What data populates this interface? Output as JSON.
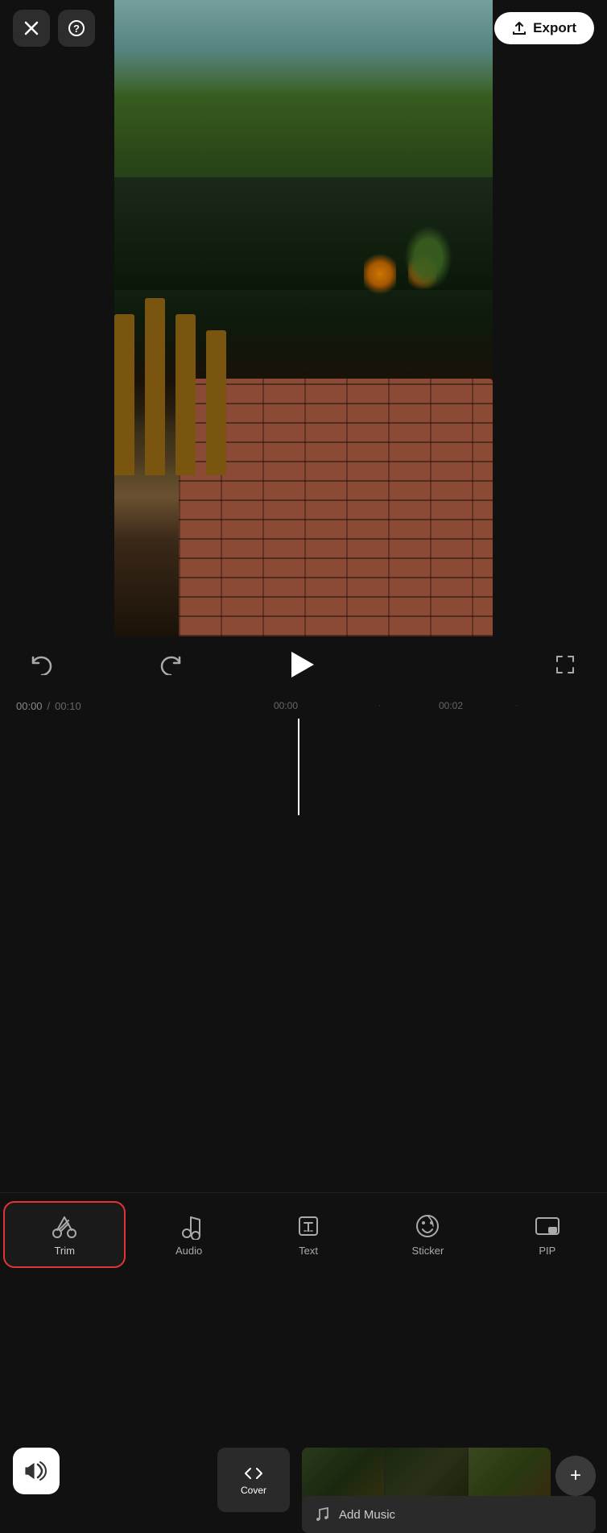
{
  "header": {
    "close_label": "✕",
    "help_label": "?",
    "export_label": "Export"
  },
  "controls": {
    "undo_label": "⟵",
    "redo_label": "⟶",
    "play_label": "▶",
    "fullscreen_label": "⛶"
  },
  "timeline": {
    "current_time": "00:00",
    "total_time": "00:10",
    "time_separator": "/",
    "marker_0": "00:00",
    "marker_2": "00:02",
    "cover_label": "Cover",
    "add_music_label": "Add Music",
    "add_clip_label": "+"
  },
  "toolbar": {
    "items": [
      {
        "id": "trim",
        "label": "Trim",
        "icon": "trim"
      },
      {
        "id": "audio",
        "label": "Audio",
        "icon": "audio"
      },
      {
        "id": "text",
        "label": "Text",
        "icon": "text"
      },
      {
        "id": "sticker",
        "label": "Sticker",
        "icon": "sticker"
      },
      {
        "id": "pip",
        "label": "PIP",
        "icon": "pip"
      }
    ],
    "active_item": "trim"
  },
  "colors": {
    "bg": "#111111",
    "active_border": "#e53333",
    "toolbar_icon": "#aaaaaa",
    "white": "#ffffff",
    "export_bg": "#ffffff",
    "export_text": "#111111",
    "playhead": "#ffffff"
  }
}
